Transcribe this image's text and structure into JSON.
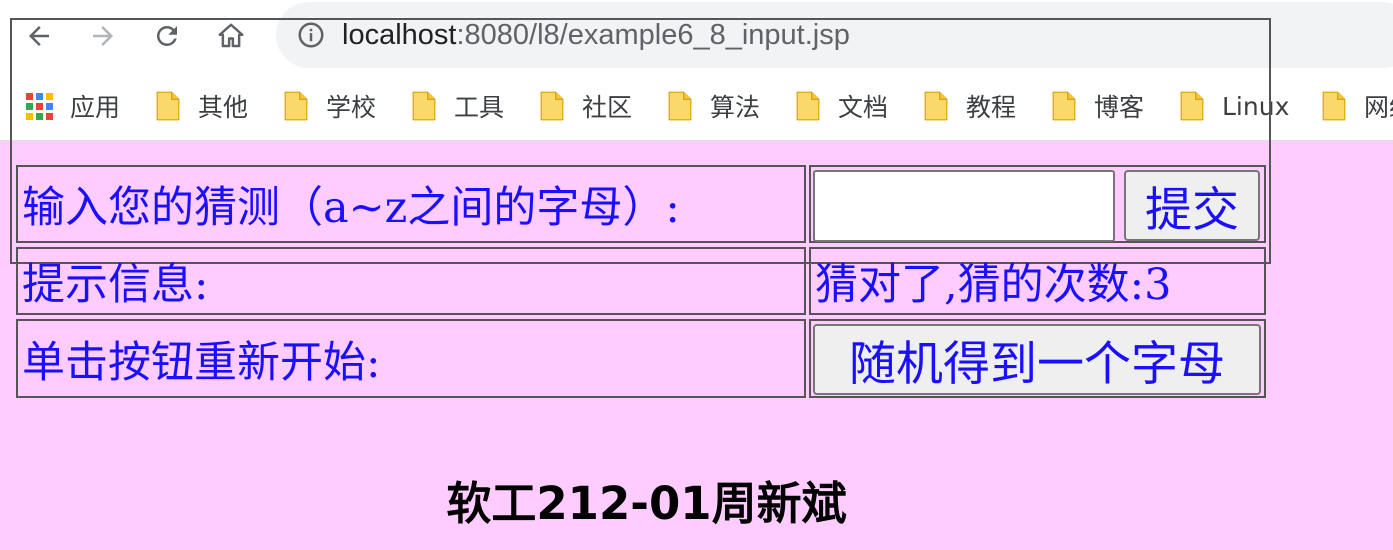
{
  "browser": {
    "url_host": "localhost",
    "url_path": ":8080/l8/example6_8_input.jsp",
    "bookmarks": [
      {
        "label": "应用",
        "icon": "apps-grid-icon"
      },
      {
        "label": "其他",
        "icon": "folder-icon"
      },
      {
        "label": "学校",
        "icon": "folder-icon"
      },
      {
        "label": "工具",
        "icon": "folder-icon"
      },
      {
        "label": "社区",
        "icon": "folder-icon"
      },
      {
        "label": "算法",
        "icon": "folder-icon"
      },
      {
        "label": "文档",
        "icon": "folder-icon"
      },
      {
        "label": "教程",
        "icon": "folder-icon"
      },
      {
        "label": "博客",
        "icon": "folder-icon"
      },
      {
        "label": "Linux",
        "icon": "folder-icon"
      },
      {
        "label": "网络",
        "icon": "folder-icon"
      }
    ]
  },
  "form": {
    "guess_label": "输入您的猜测（a~z之间的字母）:",
    "guess_value": "",
    "submit_label": "提交",
    "hint_label": "提示信息:",
    "hint_text": "猜对了,猜的次数:3",
    "restart_label": "单击按钮重新开始:",
    "restart_button": "随机得到一个字母"
  },
  "footer": {
    "text": "软工212-01周新斌"
  },
  "colors": {
    "page_background": "#ffccff",
    "text_blue": "#1a10ff",
    "folder_yellow": "#fbd86a"
  }
}
